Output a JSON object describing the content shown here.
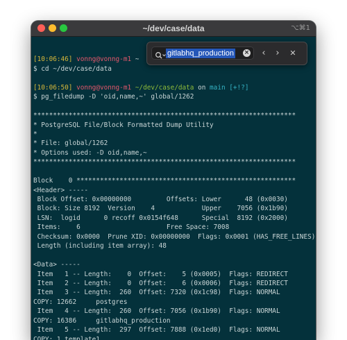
{
  "window": {
    "title": "~/dev/case/data",
    "shortcut": "⌥⌘1"
  },
  "find": {
    "query": "gitlabhq_production",
    "prev_glyph": "‹",
    "next_glyph": "›",
    "close_glyph": "✕",
    "clear_glyph": "×"
  },
  "colors": {
    "background": "#04313b",
    "prompt_time": "#d6b73a",
    "prompt_user": "#e3576b",
    "prompt_path": "#8fbc3a",
    "prompt_branch": "#35b3c4",
    "text": "#c9d5d6"
  },
  "terminal": {
    "lines": [
      {
        "segments": []
      },
      {
        "segments": [
          {
            "text": "[10:06:46] ",
            "c": "yellow"
          },
          {
            "text": "vonng@vonng-m1",
            "c": "red"
          },
          {
            "text": " ~",
            "c": "plain"
          }
        ]
      },
      {
        "segments": [
          {
            "text": "$ cd ~/dev/case/data",
            "c": "plain"
          }
        ]
      },
      {
        "segments": []
      },
      {
        "segments": [
          {
            "text": "[10:06:50] ",
            "c": "yellow"
          },
          {
            "text": "vonng@vonng-m1",
            "c": "red"
          },
          {
            "text": " ",
            "c": "plain"
          },
          {
            "text": "~/dev/case/data",
            "c": "green"
          },
          {
            "text": " on ",
            "c": "plain"
          },
          {
            "text": "main",
            "c": "cyan"
          },
          {
            "text": " ",
            "c": "plain"
          },
          {
            "text": "[+!?]",
            "c": "cyan"
          }
        ]
      },
      {
        "segments": [
          {
            "text": "$ pg_filedump -D 'oid,name,~' global/1262",
            "c": "plain"
          }
        ]
      },
      {
        "segments": []
      },
      {
        "segments": [
          {
            "text": "*******************************************************************",
            "c": "plain"
          }
        ]
      },
      {
        "segments": [
          {
            "text": "* PostgreSQL File/Block Formatted Dump Utility",
            "c": "plain"
          }
        ]
      },
      {
        "segments": [
          {
            "text": "*",
            "c": "plain"
          }
        ]
      },
      {
        "segments": [
          {
            "text": "* File: global/1262",
            "c": "plain"
          }
        ]
      },
      {
        "segments": [
          {
            "text": "* Options used: -D oid,name,~",
            "c": "plain"
          }
        ]
      },
      {
        "segments": [
          {
            "text": "*******************************************************************",
            "c": "plain"
          }
        ]
      },
      {
        "segments": []
      },
      {
        "segments": [
          {
            "text": "Block    0 ********************************************************",
            "c": "plain"
          }
        ]
      },
      {
        "segments": [
          {
            "text": "<Header> -----",
            "c": "plain"
          }
        ]
      },
      {
        "segments": [
          {
            "text": " Block Offset: 0x00000000         Offsets: Lower      48 (0x0030)",
            "c": "plain"
          }
        ]
      },
      {
        "segments": [
          {
            "text": " Block: Size 8192  Version    4            Upper    7056 (0x1b90)",
            "c": "plain"
          }
        ]
      },
      {
        "segments": [
          {
            "text": " LSN:  logid      0 recoff 0x0154f648      Special  8192 (0x2000)",
            "c": "plain"
          }
        ]
      },
      {
        "segments": [
          {
            "text": " Items:    6                      Free Space: 7008",
            "c": "plain"
          }
        ]
      },
      {
        "segments": [
          {
            "text": " Checksum: 0x0000  Prune XID: 0x00000000  Flags: 0x0001 (HAS_FREE_LINES)",
            "c": "plain"
          }
        ]
      },
      {
        "segments": [
          {
            "text": " Length (including item array): 48",
            "c": "plain"
          }
        ]
      },
      {
        "segments": []
      },
      {
        "segments": [
          {
            "text": "<Data> -----",
            "c": "plain"
          }
        ]
      },
      {
        "segments": [
          {
            "text": " Item   1 -- Length:    0  Offset:    5 (0x0005)  Flags: REDIRECT",
            "c": "plain"
          }
        ]
      },
      {
        "segments": [
          {
            "text": " Item   2 -- Length:    0  Offset:    6 (0x0006)  Flags: REDIRECT",
            "c": "plain"
          }
        ]
      },
      {
        "segments": [
          {
            "text": " Item   3 -- Length:  260  Offset: 7320 (0x1c98)  Flags: NORMAL",
            "c": "plain"
          }
        ]
      },
      {
        "segments": [
          {
            "text": "COPY: 12662     postgres",
            "c": "plain"
          }
        ]
      },
      {
        "segments": [
          {
            "text": " Item   4 -- Length:  260  Offset: 7056 (0x1b90)  Flags: NORMAL",
            "c": "plain"
          }
        ]
      },
      {
        "segments": [
          {
            "text": "COPY: 16386     gitlabhq_production",
            "c": "plain"
          }
        ]
      },
      {
        "segments": [
          {
            "text": " Item   5 -- Length:  297  Offset: 7888 (0x1ed0)  Flags: NORMAL",
            "c": "plain"
          }
        ]
      },
      {
        "segments": [
          {
            "text": "COPY: 1 template1",
            "c": "plain"
          }
        ]
      }
    ]
  }
}
